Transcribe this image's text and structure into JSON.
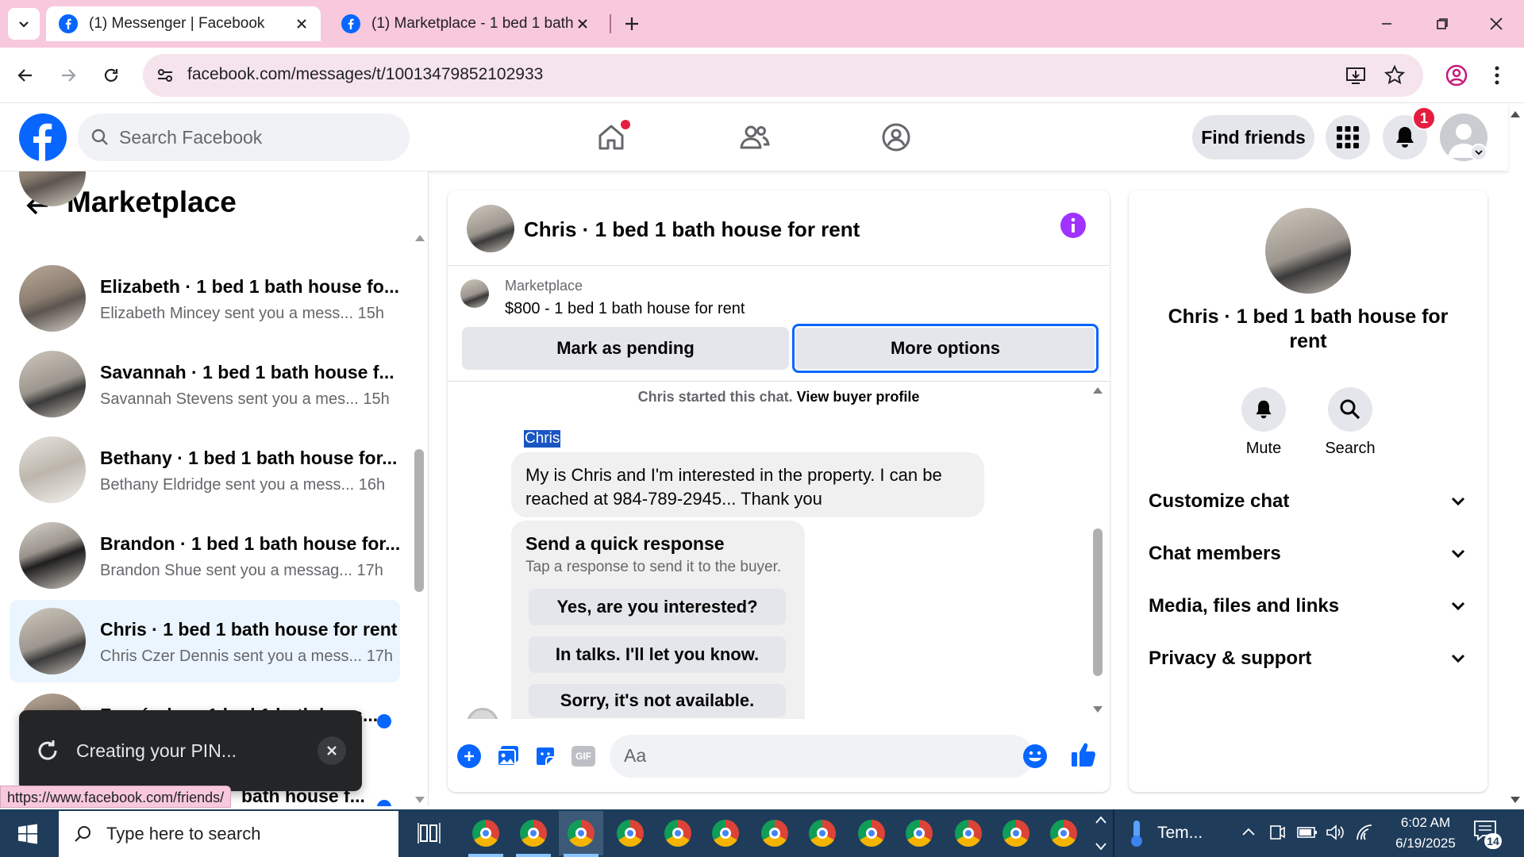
{
  "browser": {
    "tabs": [
      {
        "label": "(1) Messenger | Facebook",
        "active": true
      },
      {
        "label": "(1) Marketplace - 1 bed 1 bath h",
        "active": false
      }
    ],
    "url": "facebook.com/messages/t/10013479852102933",
    "status_url": "https://www.facebook.com/friends/"
  },
  "fb_header": {
    "search_placeholder": "Search Facebook",
    "find_friends": "Find friends",
    "notification_count": "1"
  },
  "left": {
    "title": "Marketplace",
    "conversations": [
      {
        "title": "Elizabeth · 1 bed 1 bath house fo...",
        "preview": "Elizabeth Mincey sent you a mess...",
        "time": "15h"
      },
      {
        "title": "Savannah · 1 bed 1 bath house f...",
        "preview": "Savannah Stevens sent you a mes...",
        "time": "15h"
      },
      {
        "title": "Bethany · 1 bed 1 bath house for...",
        "preview": "Bethany Eldridge sent you a mess...",
        "time": "16h"
      },
      {
        "title": "Brandon · 1 bed 1 bath house for...",
        "preview": "Brandon Shue sent you a messag...",
        "time": "17h"
      },
      {
        "title": "Chris · 1 bed 1 bath house for rent",
        "preview": "Chris Czer Dennis sent you a mess...",
        "time": "17h"
      },
      {
        "title": "Fernández · 1 bed 1 bath hous..."
      },
      {
        "title": "bath house f..."
      }
    ],
    "toast": "Creating your PIN..."
  },
  "chat": {
    "header_title": "Chris · 1 bed 1 bath house for rent",
    "listing_source": "Marketplace",
    "listing_title": "$800 - 1 bed 1 bath house for rent",
    "mark_pending": "Mark as pending",
    "more_options": "More options",
    "started_text": "Chris started this chat.",
    "view_buyer": "View buyer profile",
    "sender_name": "Chris",
    "message": "My is Chris and I'm interested in the property. I can be reached at 984-789-2945... Thank you",
    "quick_title": "Send a quick response",
    "quick_sub": "Tap a response to send it to the buyer.",
    "quick_replies": [
      "Yes, are you interested?",
      "In talks. I'll let you know.",
      "Sorry, it's not available."
    ],
    "composer_placeholder": "Aa",
    "gif_label": "GIF"
  },
  "info": {
    "name": "Chris · 1 bed 1 bath house for rent",
    "mute": "Mute",
    "search": "Search",
    "sections": [
      "Customize chat",
      "Chat members",
      "Media, files and links",
      "Privacy & support"
    ]
  },
  "taskbar": {
    "search_placeholder": "Type here to search",
    "weather": "Tem...",
    "time": "6:02 AM",
    "date": "6/19/2025",
    "notif_count": "14"
  },
  "colors": {
    "fb_blue": "#0866ff",
    "messenger_purple": "#a033ff",
    "tabbar_pink": "#f8c8dc",
    "notify_red": "#e41e3f"
  }
}
